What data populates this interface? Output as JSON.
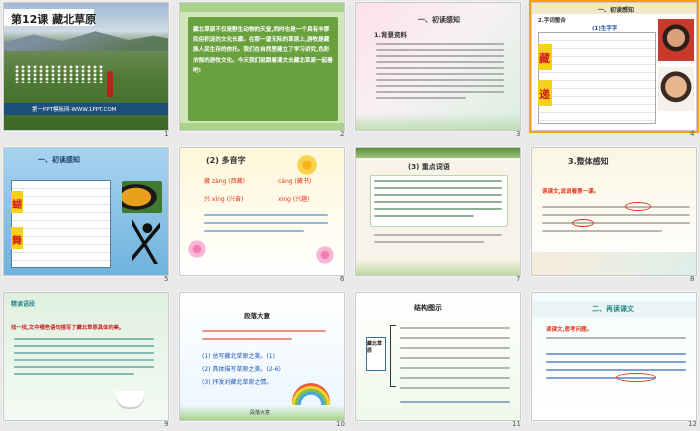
{
  "slides": [
    {
      "n": "1",
      "title": "第12课 藏北草原",
      "footer": "第一PPT模板网-WWW.1PPT.COM"
    },
    {
      "n": "2",
      "body": "藏北草原不仅是野生动物的天堂,同时也是一个具有丰厚民俗积淀的文化长廊。在那一望无际的草原上,游牧是藏族人民生存的依托。我们在自然里建立了学习讲究,色彩浓郁的游牧文化。今天我们就跟着课文去藏北草原一起看吧!"
    },
    {
      "n": "3",
      "heading": "一、初读感知",
      "sub": "1.背景资料"
    },
    {
      "n": "4",
      "heading": "一、初读感知",
      "sub": "2.字词整合",
      "colhead": "(1)生字字",
      "chars": [
        "藏",
        "递"
      ]
    },
    {
      "n": "5",
      "heading": "一、初读感知",
      "chars": [
        "蝴",
        "舞"
      ]
    },
    {
      "n": "6",
      "heading": "(2) 多音字",
      "poly1a": "藏 zàng (西藏)",
      "poly1b": "cáng (藏书)",
      "poly2a": "兴 xīng (兴奋)",
      "poly2b": "xìng (兴趣)"
    },
    {
      "n": "7",
      "heading": "(3) 重点词语"
    },
    {
      "n": "8",
      "heading": "3.整体感知",
      "task": "读课文,说说看第一课。"
    },
    {
      "n": "9",
      "heading": "精读语段",
      "task": "找一找,文中哪些语句描写了藏北草原具体的美。"
    },
    {
      "n": "10",
      "heading": "段落大意",
      "items": [
        "(1) 总写藏北草原之美。(1)",
        "(2) 具体描写草原之美。(2-6)",
        "(3) 抒发对藏北草原之情。"
      ],
      "label": "段落大意"
    },
    {
      "n": "11",
      "heading": "结构图示",
      "box": "藏北草原"
    },
    {
      "n": "12",
      "heading": "二、再读课文",
      "task": "读课文,思考问题。"
    }
  ],
  "colors": {
    "accent": "#f0a30a",
    "title_red": "#e0361e",
    "teal": "#2a8a86"
  }
}
